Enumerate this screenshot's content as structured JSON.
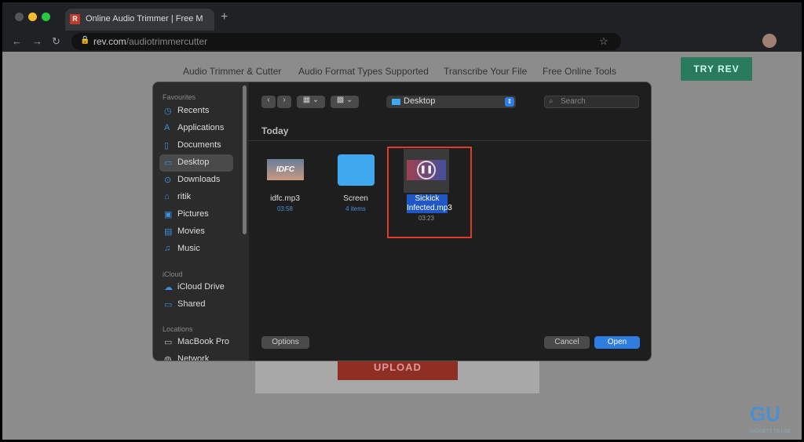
{
  "browser": {
    "tab_title": "Online Audio Trimmer | Free M",
    "url_host": "rev.com",
    "url_path": "/audiotrimmercutter"
  },
  "site": {
    "nav": [
      "Audio Trimmer & Cutter",
      "Audio Format Types Supported",
      "Transcribe Your File",
      "Free Online Tools"
    ],
    "try_rev": "TRY REV",
    "upload": "UPLOAD"
  },
  "dialog": {
    "sections": {
      "favourites": "Favourites",
      "icloud": "iCloud",
      "locations": "Locations"
    },
    "sidebar": [
      {
        "label": "Recents",
        "icon": "clock-icon"
      },
      {
        "label": "Applications",
        "icon": "applications-icon"
      },
      {
        "label": "Documents",
        "icon": "document-icon"
      },
      {
        "label": "Desktop",
        "icon": "desktop-icon",
        "selected": true
      },
      {
        "label": "Downloads",
        "icon": "download-icon"
      },
      {
        "label": "ritik",
        "icon": "home-icon"
      },
      {
        "label": "Pictures",
        "icon": "pictures-icon"
      },
      {
        "label": "Movies",
        "icon": "movies-icon"
      },
      {
        "label": "Music",
        "icon": "music-icon"
      },
      {
        "label": "iCloud Drive",
        "icon": "cloud-icon"
      },
      {
        "label": "Shared",
        "icon": "shared-folder-icon"
      },
      {
        "label": "MacBook Pro",
        "icon": "laptop-icon"
      },
      {
        "label": "Network",
        "icon": "network-icon"
      }
    ],
    "location": "Desktop",
    "search_placeholder": "Search",
    "group": "Today",
    "files": [
      {
        "name": "idfc.mp3",
        "sub": "03:58"
      },
      {
        "name": "Screen",
        "sub": "4 items"
      },
      {
        "name": "Sickick Infected.mp3",
        "sub": "03:23",
        "selected": true
      }
    ],
    "thumb_text": "IDFC",
    "options": "Options",
    "cancel": "Cancel",
    "open": "Open"
  },
  "watermark": {
    "logo": "GU",
    "text": "GADGETS TO USE"
  },
  "colors": {
    "accent": "#2f7de1",
    "highlight_box": "#e03a2a",
    "try_rev": "#2a7a5e",
    "upload": "#8f2e22"
  }
}
